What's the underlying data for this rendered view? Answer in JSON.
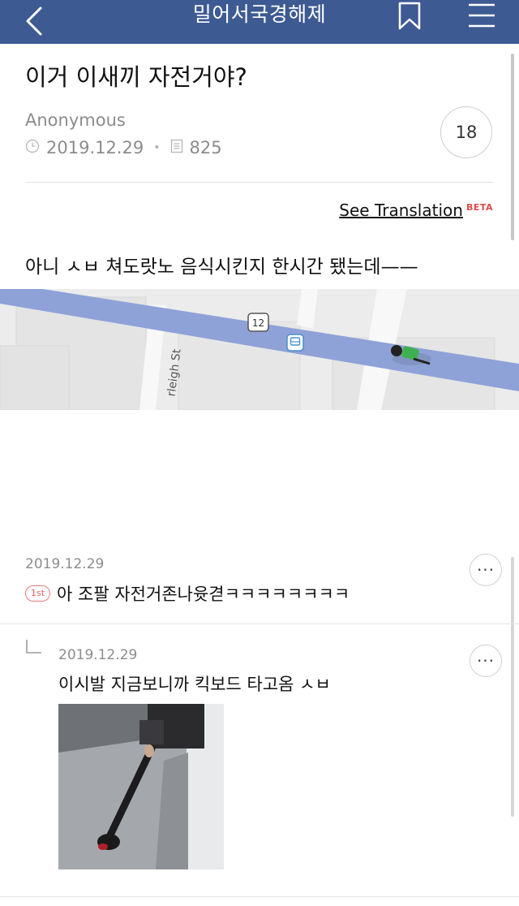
{
  "header": {
    "title": "밀어서국경해제"
  },
  "post": {
    "title": "이거 이새끼 자전거야?",
    "author": "Anonymous",
    "date": "2019.12.29",
    "views": "825",
    "comment_count": "18",
    "translate_label": "See Translation",
    "beta_label": "BETA",
    "body": "아니 ㅅㅂ 쳐도랏노 음식시킨지 한시간 됐는데——"
  },
  "map": {
    "route_badge": "12",
    "street_label": "rleigh St"
  },
  "comments": [
    {
      "date": "2019.12.29",
      "badge": "1st",
      "text": "아 조팔 자전거존나윳겯ㅋㅋㅋㅋㅋㅋㅋㅋ",
      "more": "···"
    },
    {
      "date": "2019.12.29",
      "text": "이시발 지금보니까 킥보드 타고옴 ㅅㅂ",
      "more": "···"
    }
  ],
  "colors": {
    "header_bg": "#3d5a93",
    "map_road": "#8ea2d8",
    "beta": "#e04a4a",
    "first_badge": "#e06060"
  },
  "icons": [
    "back-arrow-icon",
    "bookmark-icon",
    "hamburger-menu-icon",
    "clock-icon",
    "document-icon",
    "more-icon",
    "reply-arrow-icon",
    "bus-stop-icon",
    "route-shield-icon"
  ]
}
